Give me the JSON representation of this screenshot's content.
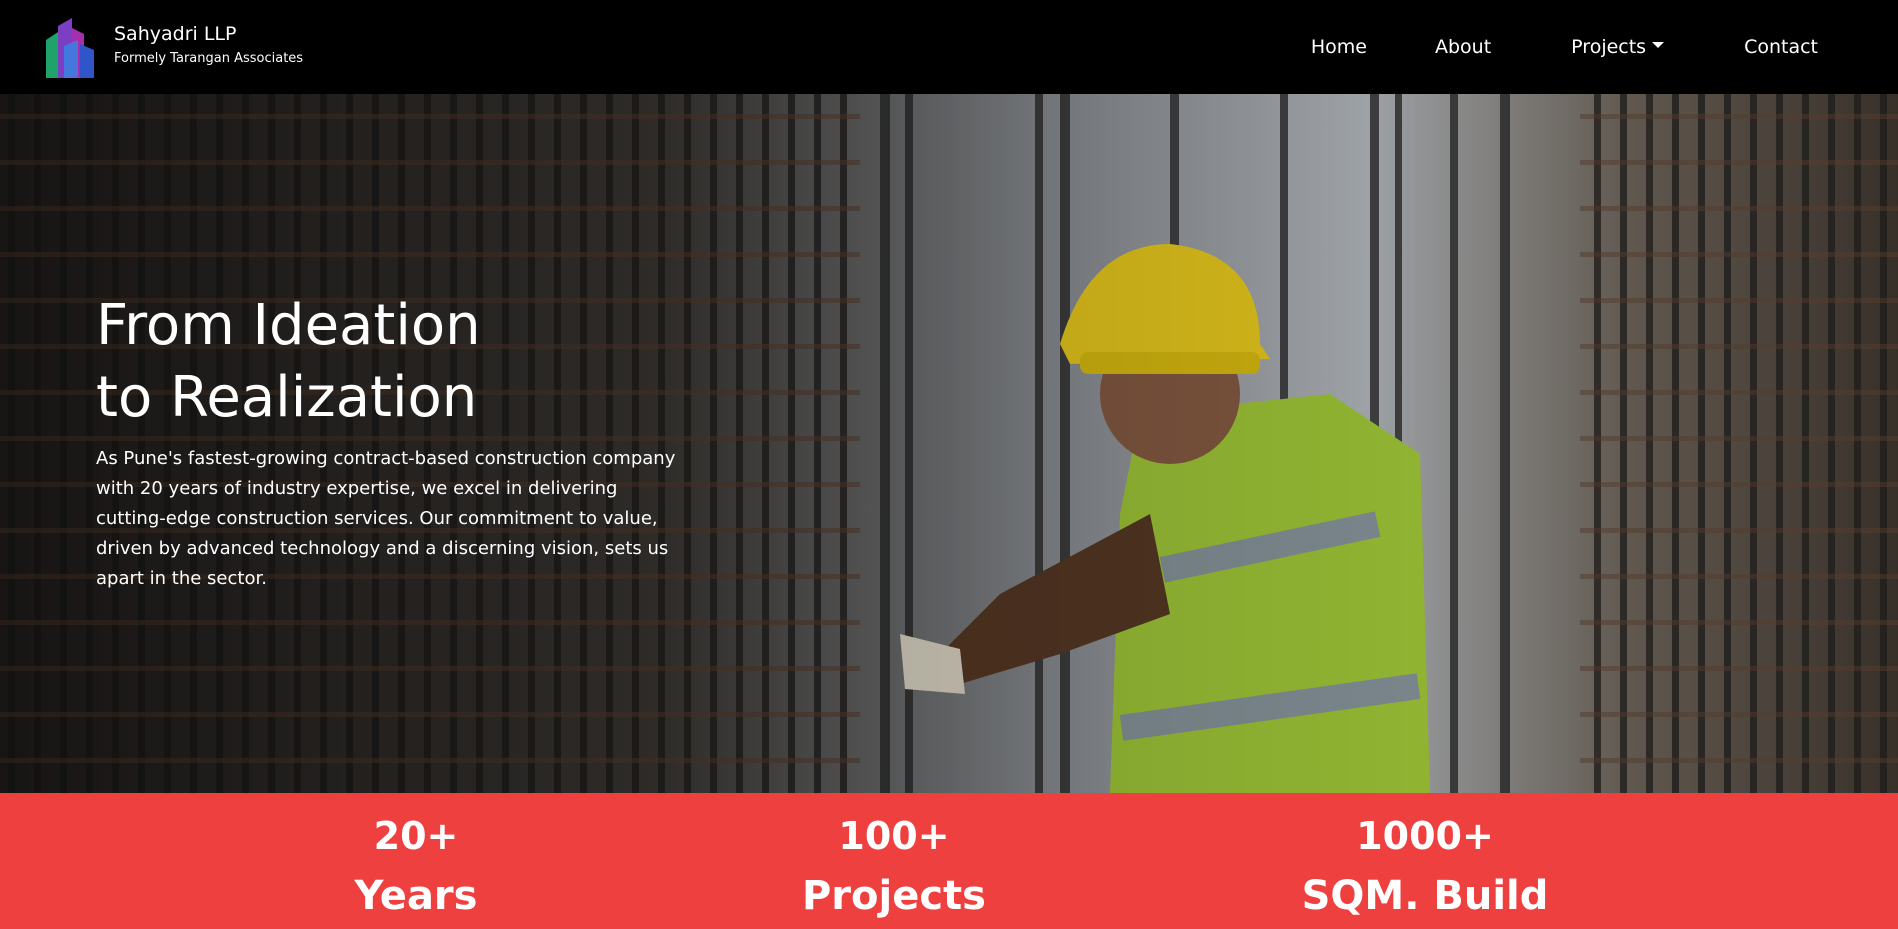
{
  "brand": {
    "name": "Sahyadri LLP",
    "subtitle": "Formely Tarangan Associates"
  },
  "nav": {
    "home": "Home",
    "about": "About",
    "projects": "Projects",
    "contact": "Contact"
  },
  "hero": {
    "title_line1": "From Ideation",
    "title_line2": "to Realization",
    "description": "As Pune's fastest-growing contract-based construction company with 20 years of industry expertise, we excel in delivering cutting-edge construction services. Our commitment to value, driven by advanced technology and a discerning vision, sets us apart in the sector."
  },
  "stats": [
    {
      "number": "20+",
      "label": "Years"
    },
    {
      "number": "100+",
      "label": "Projects"
    },
    {
      "number": "1000+",
      "label": "SQM. Build"
    }
  ],
  "colors": {
    "navbar_bg": "#000000",
    "stats_bg": "#ef4040",
    "text": "#ffffff"
  }
}
